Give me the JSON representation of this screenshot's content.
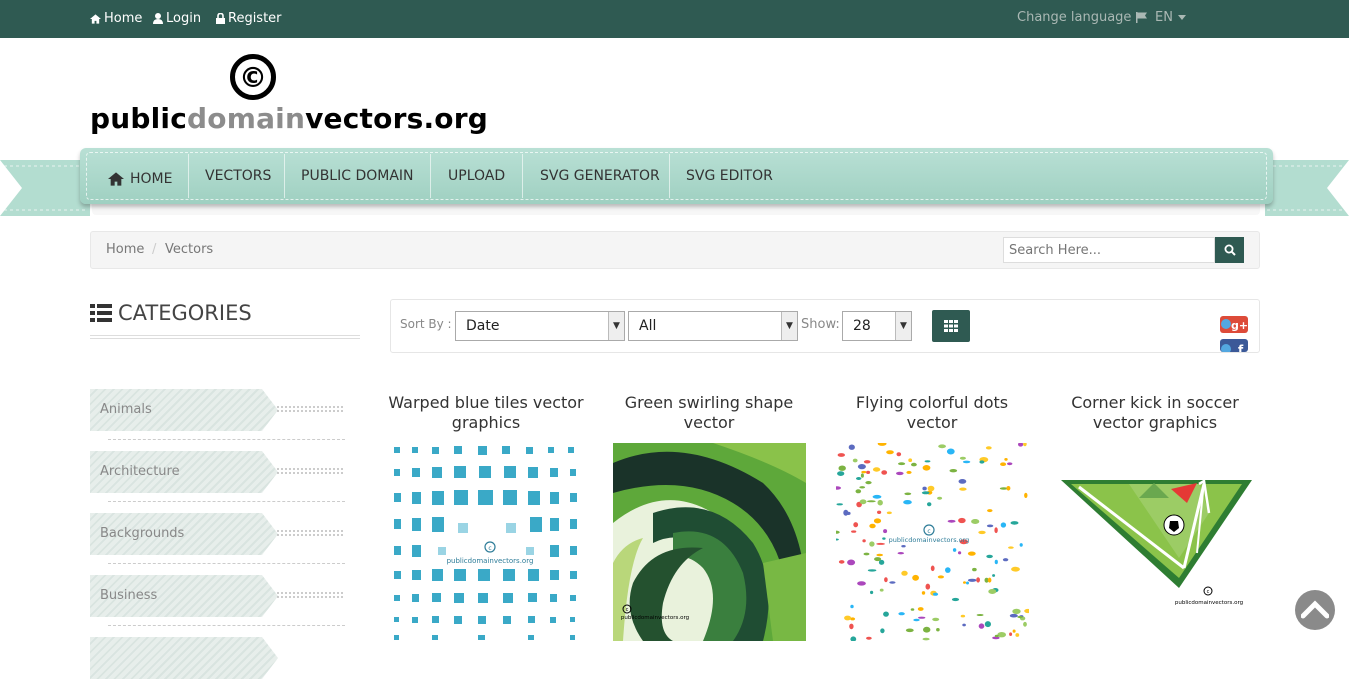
{
  "topbar": {
    "home": "Home",
    "login": "Login",
    "register": "Register",
    "change_language": "Change language",
    "language": "EN"
  },
  "logo": {
    "symbol": "©",
    "part1": "public",
    "part2": "domain",
    "part3": "vectors.org"
  },
  "nav": {
    "items": [
      "HOME",
      "VECTORS",
      "PUBLIC DOMAIN",
      "UPLOAD",
      "SVG GENERATOR",
      "SVG EDITOR"
    ]
  },
  "breadcrumb": {
    "home": "Home",
    "separator": "/",
    "current": "Vectors"
  },
  "search": {
    "placeholder": "Search Here..."
  },
  "categories": {
    "title": "CATEGORIES",
    "items": [
      "Animals",
      "Architecture",
      "Backgrounds",
      "Business"
    ]
  },
  "toolbar": {
    "sort_label": "Sort By :",
    "sort_value": "Date",
    "filter_value": "All",
    "show_label": "Show:",
    "show_value": "28"
  },
  "items": [
    {
      "title": "Warped blue tiles vector graphics"
    },
    {
      "title": "Green swirling shape vector"
    },
    {
      "title": "Flying colorful dots vector"
    },
    {
      "title": "Corner kick in soccer vector graphics"
    }
  ],
  "watermark": "publicdomainvectors.org",
  "colors": {
    "topbar": "#2f5a52",
    "nav": "#a8d7c8",
    "accent": "#2f5a52"
  },
  "icons": [
    "home-icon",
    "user-icon",
    "lock-icon",
    "flag-icon",
    "caret-down-icon",
    "search-icon",
    "list-icon",
    "grid-icon",
    "google-plus-icon",
    "facebook-icon",
    "arrow-up-icon"
  ]
}
